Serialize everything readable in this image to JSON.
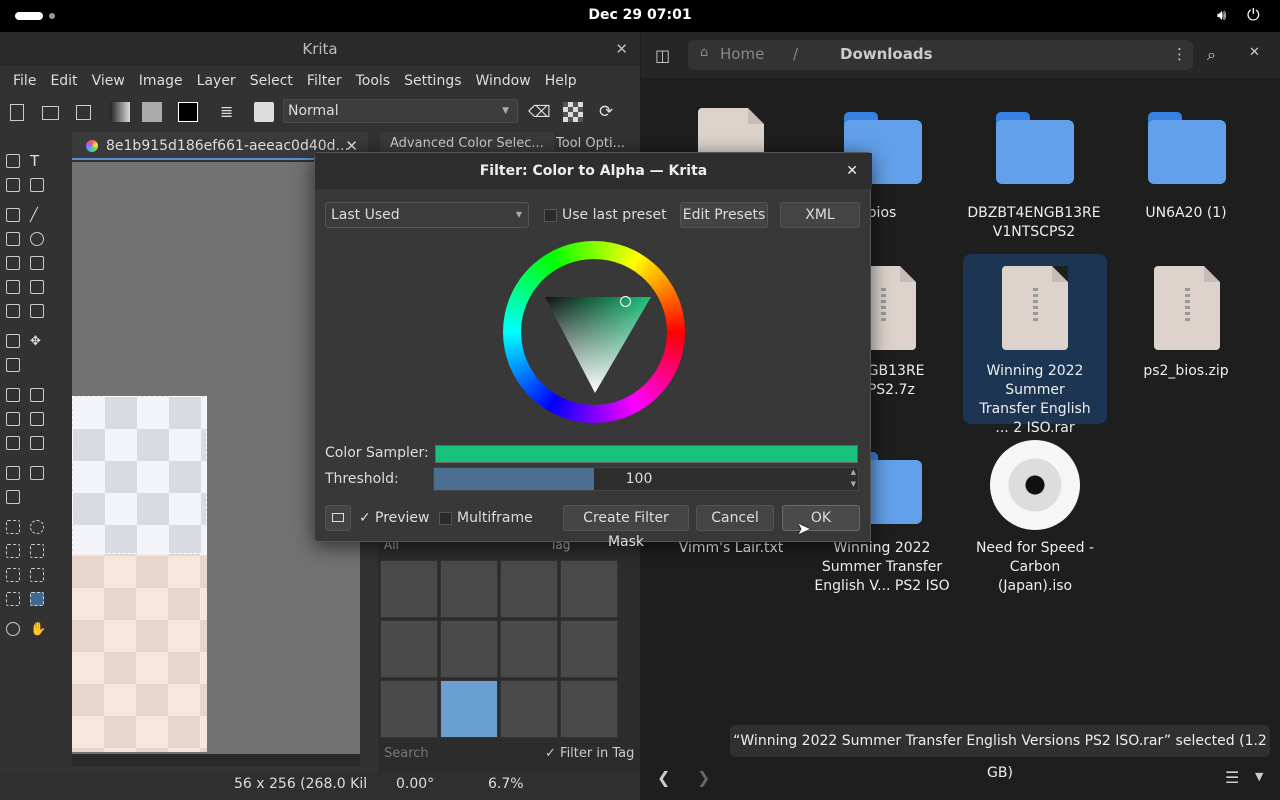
{
  "topbar": {
    "clock": "Dec 29  07:01"
  },
  "krita": {
    "title": "Krita",
    "menu": [
      "File",
      "Edit",
      "View",
      "Image",
      "Layer",
      "Select",
      "Filter",
      "Tools",
      "Settings",
      "Window",
      "Help"
    ],
    "blend_mode": "Normal",
    "doc_tab": "8e1b915d186ef661-aeeac0d40d...",
    "dock_tabs": [
      "Advanced Color Selec...",
      "Tool Opti..."
    ],
    "brush_filter": "All",
    "brush_tag": "Tag",
    "brush_search_placeholder": "Search",
    "filter_in_tag": "Filter in Tag",
    "status": {
      "size": "56 x 256 (268.0 Kil",
      "rotation": "0.00°",
      "zoom": "6.7%"
    }
  },
  "dialog": {
    "title": "Filter: Color to Alpha — Krita",
    "preset": "Last Used",
    "use_last_preset": "Use last preset",
    "edit_presets": "Edit Presets",
    "xml": "XML",
    "color_sampler_label": "Color Sampler:",
    "color_sampler_value": "#18c27a",
    "threshold_label": "Threshold:",
    "threshold_value": "100",
    "preview": "Preview",
    "multiframe": "Multiframe",
    "create_filter_mask": "Create Filter Mask",
    "cancel": "Cancel",
    "ok": "OK"
  },
  "files": {
    "breadcrumb_home": "Home",
    "breadcrumb_sep": "/",
    "breadcrumb_current": "Downloads",
    "items": [
      {
        "name": "bios"
      },
      {
        "name": "DBZBT4ENGB13RE V1NTSCPS2"
      },
      {
        "name": "UN6A20 (1)"
      },
      {
        "name": "4ENGB13RE SCPS2.7z"
      },
      {
        "name": "Winning 2022 Summer Transfer English ...  2 ISO.rar"
      },
      {
        "name": "ps2_bios.zip"
      },
      {
        "name": "Vimm's Lair.txt"
      },
      {
        "name": "Winning 2022 Summer Transfer English V...  PS2 ISO"
      },
      {
        "name": "Need for Speed - Carbon (Japan).iso"
      }
    ],
    "status": "“Winning 2022 Summer Transfer English Versions PS2 ISO.rar” selected  (1.2 GB)"
  }
}
